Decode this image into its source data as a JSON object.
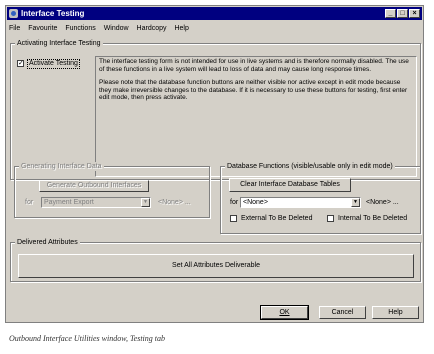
{
  "window": {
    "title": "Interface Testing",
    "buttons": {
      "minimize": "_",
      "maximize": "□",
      "close": "×"
    }
  },
  "menu": [
    {
      "label": "File"
    },
    {
      "label": "Favourite"
    },
    {
      "label": "Functions"
    },
    {
      "label": "Window"
    },
    {
      "label": "Hardcopy"
    },
    {
      "label": "Help"
    }
  ],
  "activating": {
    "group_label": "Activating Interface Testing",
    "checkbox_label": "Activate Testing",
    "checked": true,
    "info_para1": "The interface testing form is not intended for use in live systems and is therefore normally disabled. The use of these functions in a live system will lead to loss of data and may cause long response times.",
    "info_para2": "Please note that the database function buttons are neither visible nor active except in edit mode because they make irreversible changes to the database. If it is necessary to use these buttons for testing, first enter edit mode, then press activate."
  },
  "generating": {
    "group_label": "Generating Interface Data",
    "button_label": "Generate Outbound Interfaces",
    "for_label": "for",
    "combo_value": "Payment Export",
    "combo_arrow": "▼",
    "extra_value": "<None> ..."
  },
  "db_functions": {
    "group_label": "Database Functions (visible/usable only in edit mode)",
    "button_label": "Clear Interface Database Tables",
    "for_label": "for",
    "combo_value": "<None>",
    "combo_arrow": "▼",
    "extra_value": "<None> ...",
    "external_label": "External To Be Deleted",
    "internal_label": "Internal To Be Deleted"
  },
  "delivered": {
    "group_label": "Delivered Attributes",
    "button_label": "Set All Attributes Deliverable"
  },
  "footer_buttons": {
    "ok": "OK",
    "cancel": "Cancel",
    "help": "Help"
  },
  "caption": "Outbound Interface Utilities window, Testing tab"
}
